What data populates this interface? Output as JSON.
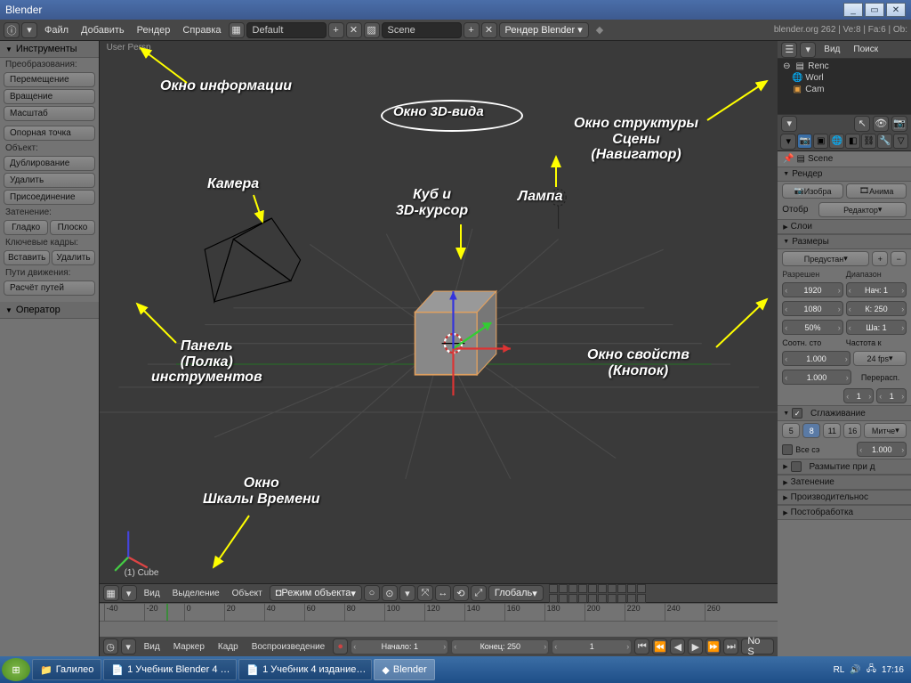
{
  "window": {
    "title": "Blender"
  },
  "info_bar": {
    "menus": [
      "Файл",
      "Добавить",
      "Рендер",
      "Справка"
    ],
    "layout": "Default",
    "scene": "Scene",
    "engine": "Рендер Blender",
    "stats": "blender.org 262 | Ve:8 | Fa:6 | Ob:"
  },
  "tool_shelf": {
    "header": "Инструменты",
    "sec_transform": "Преобразования:",
    "btn_translate": "Перемещение",
    "btn_rotate": "Вращение",
    "btn_scale": "Масштаб",
    "btn_origin": "Опорная точка",
    "sec_object": "Объект:",
    "btn_dup": "Дублирование",
    "btn_del": "Удалить",
    "btn_join": "Присоединение",
    "sec_shade": "Затенение:",
    "btn_smooth": "Гладко",
    "btn_flat": "Плоско",
    "sec_keys": "Ключевые кадры:",
    "btn_insert": "Вставить",
    "btn_remove": "Удалить",
    "sec_paths": "Пути движения:",
    "btn_calc": "Расчёт путей",
    "operator_header": "Оператор"
  },
  "viewport": {
    "persp": "User Persp",
    "object": "(1) Cube"
  },
  "view_header": {
    "view": "Вид",
    "select": "Выделение",
    "object": "Объект",
    "mode": "Режим объекта",
    "orient": "Глобаль"
  },
  "timeline": {
    "ticks": [
      "-40",
      "-20",
      "0",
      "20",
      "40",
      "60",
      "80",
      "100",
      "120",
      "140",
      "160",
      "180",
      "200",
      "220",
      "240",
      "260"
    ],
    "menus": [
      "Вид",
      "Маркер",
      "Кадр",
      "Воспроизведение"
    ],
    "start": "Начало: 1",
    "end": "Конец: 250",
    "current": "1",
    "nosync": "No S"
  },
  "outliner": {
    "menu_view": "Вид",
    "menu_search": "Поиск",
    "items": [
      "Renc",
      "Worl",
      "Cam"
    ]
  },
  "properties": {
    "breadcrumb": "Scene",
    "render": "Рендер",
    "btn_render": "Изобра",
    "btn_anim": "Анима",
    "display": "Отобр",
    "display_val": "Редактор",
    "layers": "Слои",
    "dimensions": "Размеры",
    "preset": "Предустан",
    "res_label": "Разрешен",
    "range_label": "Диапазон",
    "res_x": "1920",
    "res_y": "1080",
    "res_pct": "50%",
    "start": "Нач: 1",
    "end": "К: 250",
    "step": "Ша: 1",
    "aspect": "Соотн. сто",
    "framerate": "Частота к",
    "asp1": "1.000",
    "fps": "24 fps",
    "asp2": "1.000",
    "remap": "Перерасп.",
    "old": "1",
    "new": "1",
    "aa": "Сглаживание",
    "aa5": "5",
    "aa8": "8",
    "aa11": "11",
    "aa16": "16",
    "aa_filter": "Митче",
    "fullsample": "Все сэ",
    "filter_size": "1.000",
    "mblur": "Размытие при д",
    "shading": "Затенение",
    "perf": "Производительнос",
    "post": "Постобработка"
  },
  "taskbar": {
    "items": [
      "Галилео",
      "1 Учебник Blender 4 …",
      "1 Учебник 4 издание…",
      "Blender"
    ],
    "lang": "RL",
    "clock": "17:16"
  },
  "annotations": {
    "info": "Окно информации",
    "view3d": "Окно 3D-вида",
    "outliner": "Окно структуры\nСцены\n(Навигатор)",
    "camera": "Камера",
    "cube": "Куб и\n3D-курсор",
    "lamp": "Лампа",
    "tools": "Панель\n(Полка)\nинструментов",
    "props": "Окно свойств\n(Кнопок)",
    "timeline": "Окно\nШкалы Времени"
  }
}
